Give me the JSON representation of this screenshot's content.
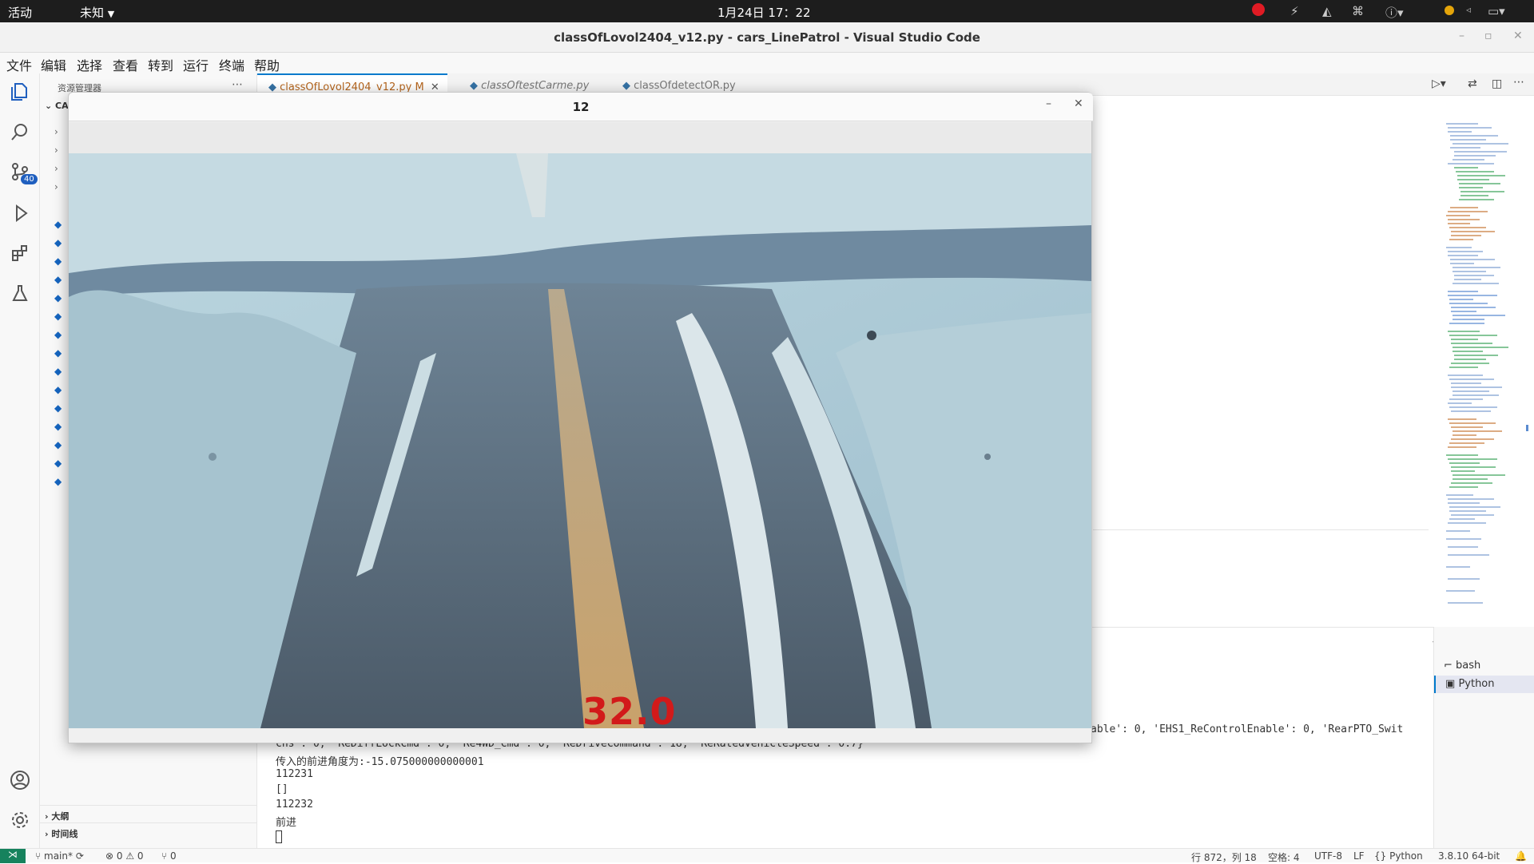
{
  "gnome": {
    "activities": "活动",
    "app_menu": "未知",
    "clock": "1月24日  17：22"
  },
  "window": {
    "title": "classOfLovol2404_v12.py - cars_LinePatrol - Visual Studio Code"
  },
  "menu": [
    "文件",
    "编辑",
    "选择",
    "查看",
    "转到",
    "运行",
    "终端",
    "帮助"
  ],
  "activity": {
    "scm_badge": "40"
  },
  "sidebar": {
    "header": "资源管理器",
    "root": "CA",
    "outline": "大纲",
    "timeline": "时间线"
  },
  "tabs": [
    {
      "label": "classOfLovol2404_v12.py",
      "modified": "M"
    },
    {
      "label": "classOftestCarme.py"
    },
    {
      "label": "classOfdetectOR.py"
    }
  ],
  "cv_window": {
    "title": "12",
    "overlay_text": "32.0"
  },
  "terminal": {
    "line_right_fragment": "able': 0, 'EHS1_ReControlEnable': 0, 'RearPTO_Swit",
    "lines": [
      "chs': 0, 'ReDiffLockCmd': 0, 'Re4WD_Cmd': 0, 'ReDriveCommand': 18, 'ReRatedVehicleSpeed': 0.7}",
      "传入的前进角度为:-15.075000000000001",
      "112231",
      "[]",
      "112232",
      "前进"
    ],
    "instances": [
      "bash",
      "Python"
    ]
  },
  "status": {
    "branch": "main*",
    "errors": "0",
    "warnings": "0",
    "ports": "0",
    "position": "行 872，列 18",
    "spaces": "空格: 4",
    "encoding": "UTF-8",
    "eol": "LF",
    "language": "Python",
    "interpreter": "3.8.10 64-bit"
  },
  "colors": {
    "accent": "#007acc",
    "overlay_red": "#d21a1a"
  }
}
